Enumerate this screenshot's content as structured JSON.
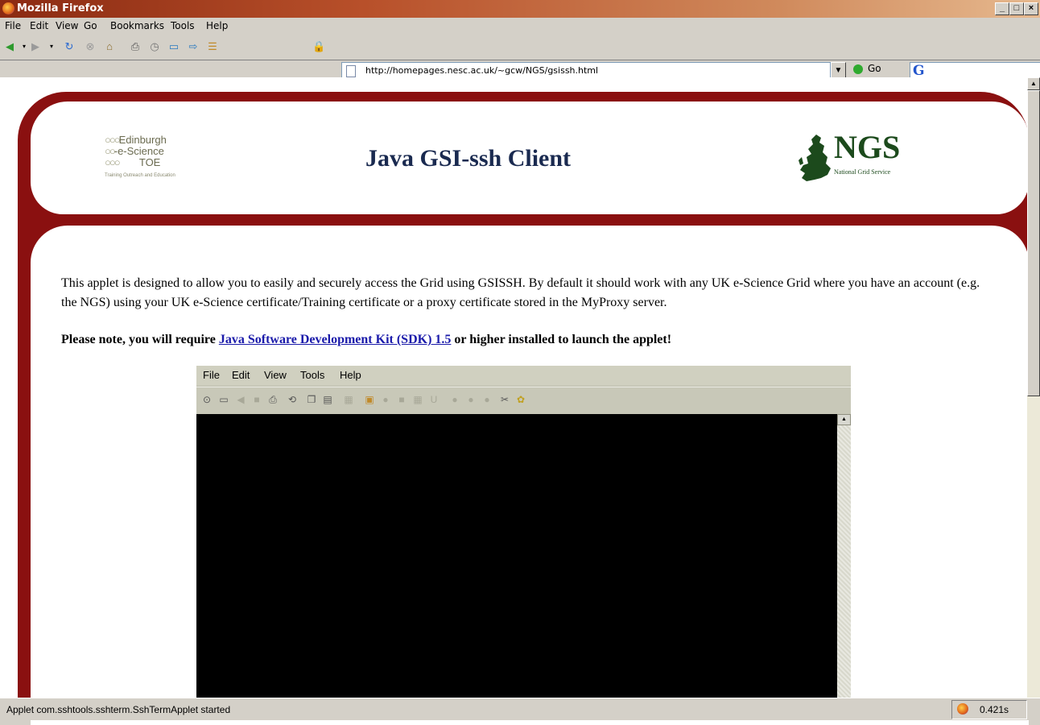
{
  "window": {
    "title": "Mozilla Firefox",
    "min_icon": "minimize-icon",
    "max_icon": "maximize-icon",
    "close_icon": "close-icon"
  },
  "menubar": {
    "items": [
      "File",
      "Edit",
      "View",
      "Go",
      "Bookmarks",
      "Tools",
      "Help"
    ]
  },
  "navbar": {
    "icons": [
      "back-icon",
      "forward-icon",
      "reload-icon",
      "stop-icon",
      "home-icon",
      "print-icon",
      "history-icon",
      "new-window-icon",
      "send-link-icon",
      "printer-icon",
      "lock-icon"
    ],
    "url": "http://homepages.nesc.ac.uk/~gcw/NGS/gsissh.html",
    "go_label": "Go",
    "search_logo": "G"
  },
  "page": {
    "title": "Java GSI-ssh Client",
    "esci_logo": {
      "line1": "Edinburgh",
      "line2": "e-Science",
      "line3": "TOE",
      "tagline": "Training Outreach and Education"
    },
    "ngs_logo": {
      "name": "NGS",
      "subtitle": "National Grid Service"
    },
    "intro": "This applet is designed to allow you to easily and securely access the Grid using GSISSH. By default it should work with any UK e-Science Grid where you have an account (e.g. the NGS) using your UK e-Science certificate/Training certificate or a proxy certificate stored in the MyProxy server.",
    "note_prefix": "Please note, you will require ",
    "note_link": "Java Software Development Kit (SDK) 1.5",
    "note_suffix": " or higher installed to launch the applet!"
  },
  "applet": {
    "menu": [
      "File",
      "Edit",
      "View",
      "Tools",
      "Help"
    ]
  },
  "status": {
    "text": "Applet com.sshtools.sshterm.SshTermApplet started",
    "timing": "0.421s"
  }
}
